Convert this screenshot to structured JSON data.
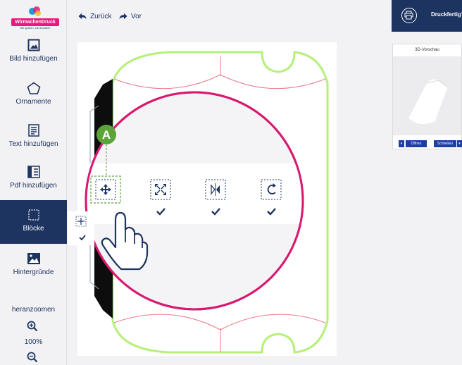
{
  "logo": {
    "wordmark": "WirmachenDruck",
    "tagline": "Sie sparen, wir drucken!"
  },
  "sidebar": {
    "items": [
      {
        "label": "Bild hinzufügen"
      },
      {
        "label": "Ornamente"
      },
      {
        "label": "Text hinzufügen"
      },
      {
        "label": "Pdf hinzufügen"
      },
      {
        "label": "Blöcke"
      },
      {
        "label": "Hintergründe"
      }
    ],
    "active_index": 4,
    "zoom_label": "heranzoomen",
    "zoom_value": "100%"
  },
  "toolbar": {
    "back_label": "Zurück",
    "forward_label": "Vor",
    "print_label": "Druckfertig?"
  },
  "preview": {
    "title": "3D-Vorschau",
    "open_label": "Öffnen",
    "close_label": "Schließen"
  },
  "callout": {
    "marker": "A"
  },
  "colors": {
    "brand": "#1d3360",
    "magenta": "#e6197d",
    "callout_green": "#6cb33e",
    "outline_green": "#b6f07a",
    "cut_red": "#e57c88"
  }
}
